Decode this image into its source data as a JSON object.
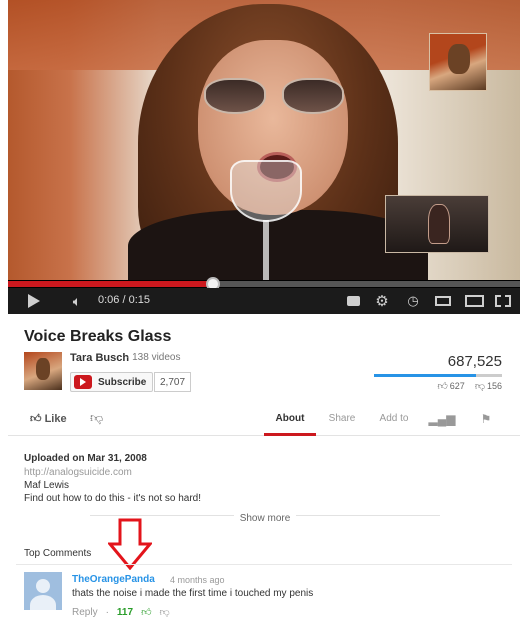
{
  "player": {
    "current_time": "0:06",
    "duration": "0:15",
    "progress_fraction": 0.4,
    "colors": {
      "progress": "#cc181e",
      "controls_bg": "#1b1b1b"
    }
  },
  "video": {
    "title": "Voice Breaks Glass",
    "channel": "Tara Busch",
    "video_count": "138 videos",
    "subscribe_label": "Subscribe",
    "subscriber_count": "2,707",
    "views": "687,525",
    "likes": "627",
    "dislikes": "156",
    "like_fraction": 0.8,
    "like_label": "Like"
  },
  "tabs": [
    {
      "label": "About",
      "active": true
    },
    {
      "label": "Share",
      "active": false
    },
    {
      "label": "Add to",
      "active": false
    }
  ],
  "description": {
    "uploaded": "Uploaded on Mar 31, 2008",
    "url": "http://analogsuicide.com",
    "line1": "Maf Lewis",
    "line2": "Find out how to do this - it's not so hard!",
    "show_more": "Show more"
  },
  "comments": {
    "header": "Top Comments",
    "items": [
      {
        "author": "TheOrangePanda",
        "time": "4 months ago",
        "text": "thats the noise i made the first time i touched my penis",
        "reply_label": "Reply",
        "likes": "117"
      }
    ]
  },
  "icons": [
    "play-icon",
    "volume-icon",
    "captions-icon",
    "gear-icon",
    "watch-later-icon",
    "small-player-icon",
    "large-player-icon",
    "fullscreen-icon",
    "youtube-icon",
    "thumbs-up-icon",
    "thumbs-down-icon",
    "stats-icon",
    "flag-icon",
    "down-arrow-icon"
  ]
}
